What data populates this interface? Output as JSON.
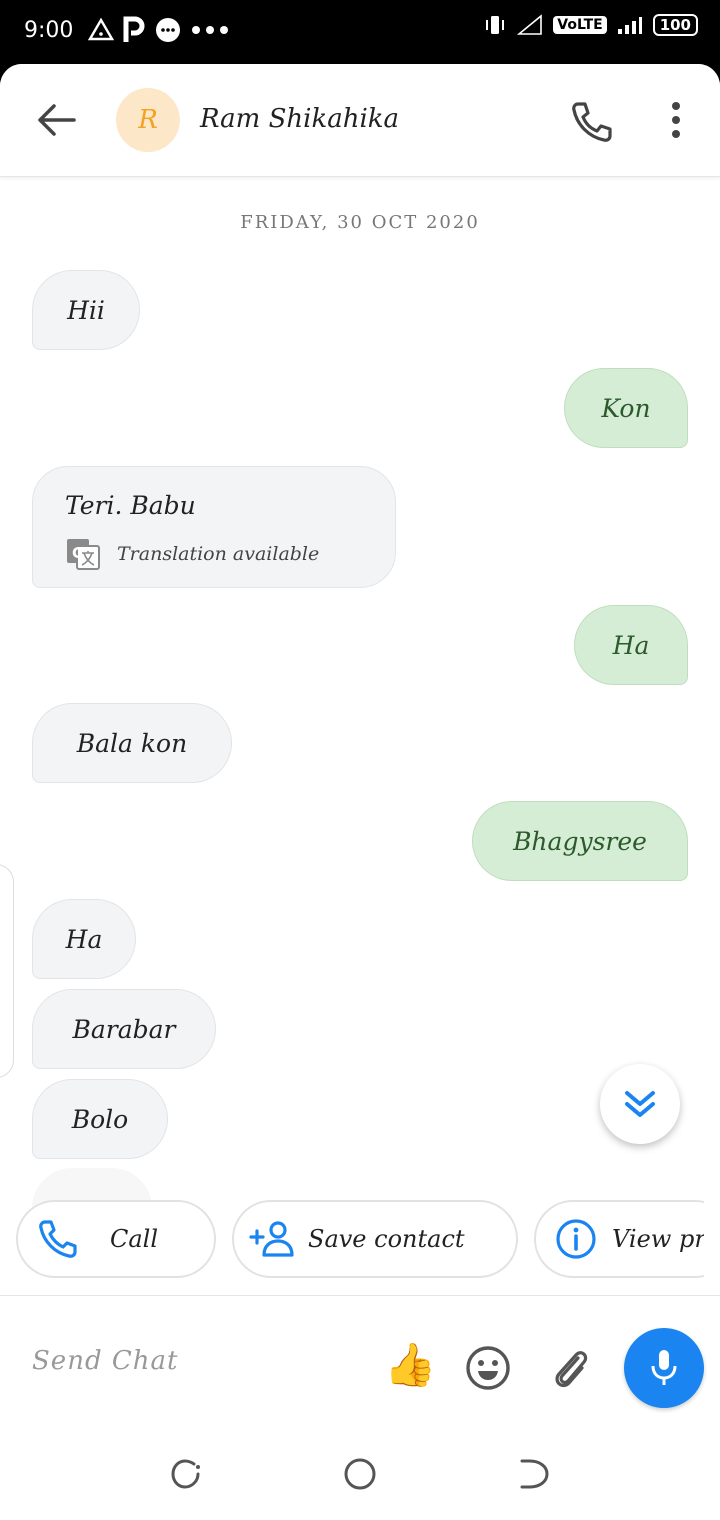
{
  "status_bar": {
    "time": "9:00",
    "left_icons": [
      "warning-triangle-icon",
      "p-app-icon",
      "chat-bubble-icon",
      "more-dots-icon"
    ],
    "right_icons": [
      "vibrate-icon",
      "signal-icon",
      "volte-icon",
      "battery-icon"
    ],
    "volte": "VoLTE",
    "battery": "100"
  },
  "header": {
    "avatar_letter": "R",
    "contact_name": "Ram Shikahika",
    "avatar_bg": "#fde7c9",
    "avatar_fg": "#f3a221"
  },
  "conversation": {
    "date": "FRIDAY, 30 OCT 2020",
    "messages": [
      {
        "dir": "in",
        "text": "Hii"
      },
      {
        "dir": "out",
        "text": "Kon"
      },
      {
        "dir": "in",
        "text": "Teri. Babu",
        "translation": "Translation available"
      },
      {
        "dir": "out",
        "text": "Ha"
      },
      {
        "dir": "in",
        "text": "Bala kon"
      },
      {
        "dir": "out",
        "text": "Bhagysree"
      },
      {
        "dir": "in",
        "text": "Ha"
      },
      {
        "dir": "in",
        "text": "Barabar"
      },
      {
        "dir": "in",
        "text": "Bolo"
      }
    ]
  },
  "suggestions": [
    {
      "label": "Call",
      "icon": "phone-icon"
    },
    {
      "label": "Save contact",
      "icon": "add-person-icon"
    },
    {
      "label": "View pr",
      "icon": "info-icon"
    }
  ],
  "composer": {
    "placeholder": "Send Chat",
    "thumb": "👍",
    "accent": "#1a84f0"
  },
  "colors": {
    "incoming_bubble": "#f3f4f6",
    "outgoing_bubble": "#d6edd5",
    "icon_blue": "#1a84f0"
  }
}
